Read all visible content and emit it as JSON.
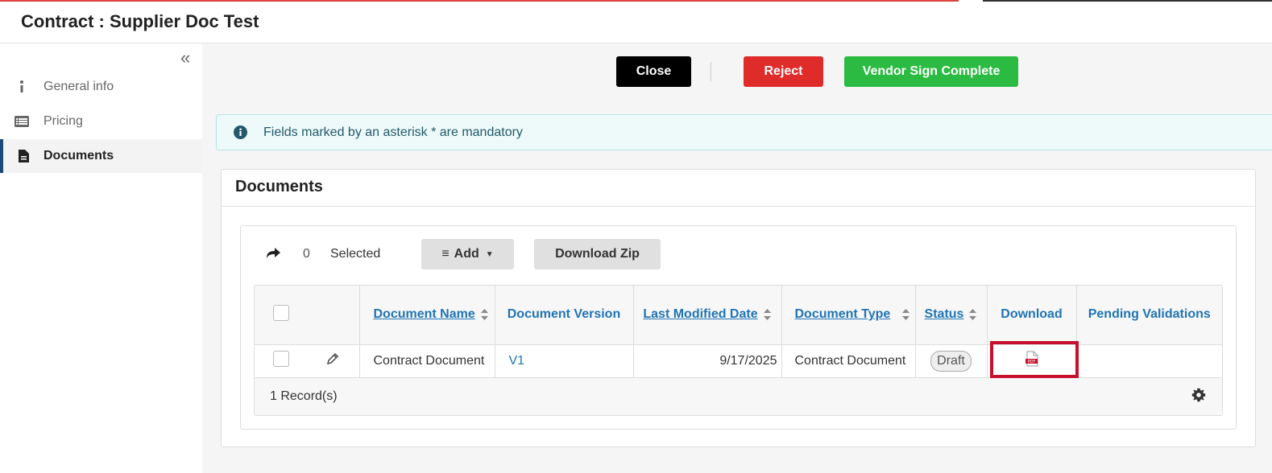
{
  "header": {
    "title": "Contract : Supplier Doc Test"
  },
  "sidebar": {
    "items": [
      {
        "label": "General info",
        "icon": "info-icon"
      },
      {
        "label": "Pricing",
        "icon": "list-icon"
      },
      {
        "label": "Documents",
        "icon": "file-icon"
      }
    ]
  },
  "actions": {
    "close": "Close",
    "reject": "Reject",
    "vendor_sign": "Vendor Sign Complete"
  },
  "colors": {
    "close": "#000000",
    "reject": "#e02b2b",
    "vendor_sign": "#2bbb42",
    "link": "#1f74b5",
    "highlight": "#c8102e"
  },
  "info": {
    "text": "Fields marked by an asterisk * are mandatory"
  },
  "documents": {
    "title": "Documents",
    "selected_count": "0",
    "selected_label": "Selected",
    "add_label": "Add",
    "download_zip": "Download Zip",
    "columns": {
      "name": "Document Name",
      "version": "Document Version",
      "modified": "Last Modified Date",
      "type": "Document Type",
      "status": "Status",
      "download": "Download",
      "pending": "Pending Validations"
    },
    "rows": [
      {
        "name": "Contract Document",
        "version": "V1",
        "modified": "9/17/2025",
        "type": "Contract Document",
        "status": "Draft",
        "download_icon": "pdf-icon",
        "pending": ""
      }
    ],
    "record_count": "1 Record(s)"
  }
}
